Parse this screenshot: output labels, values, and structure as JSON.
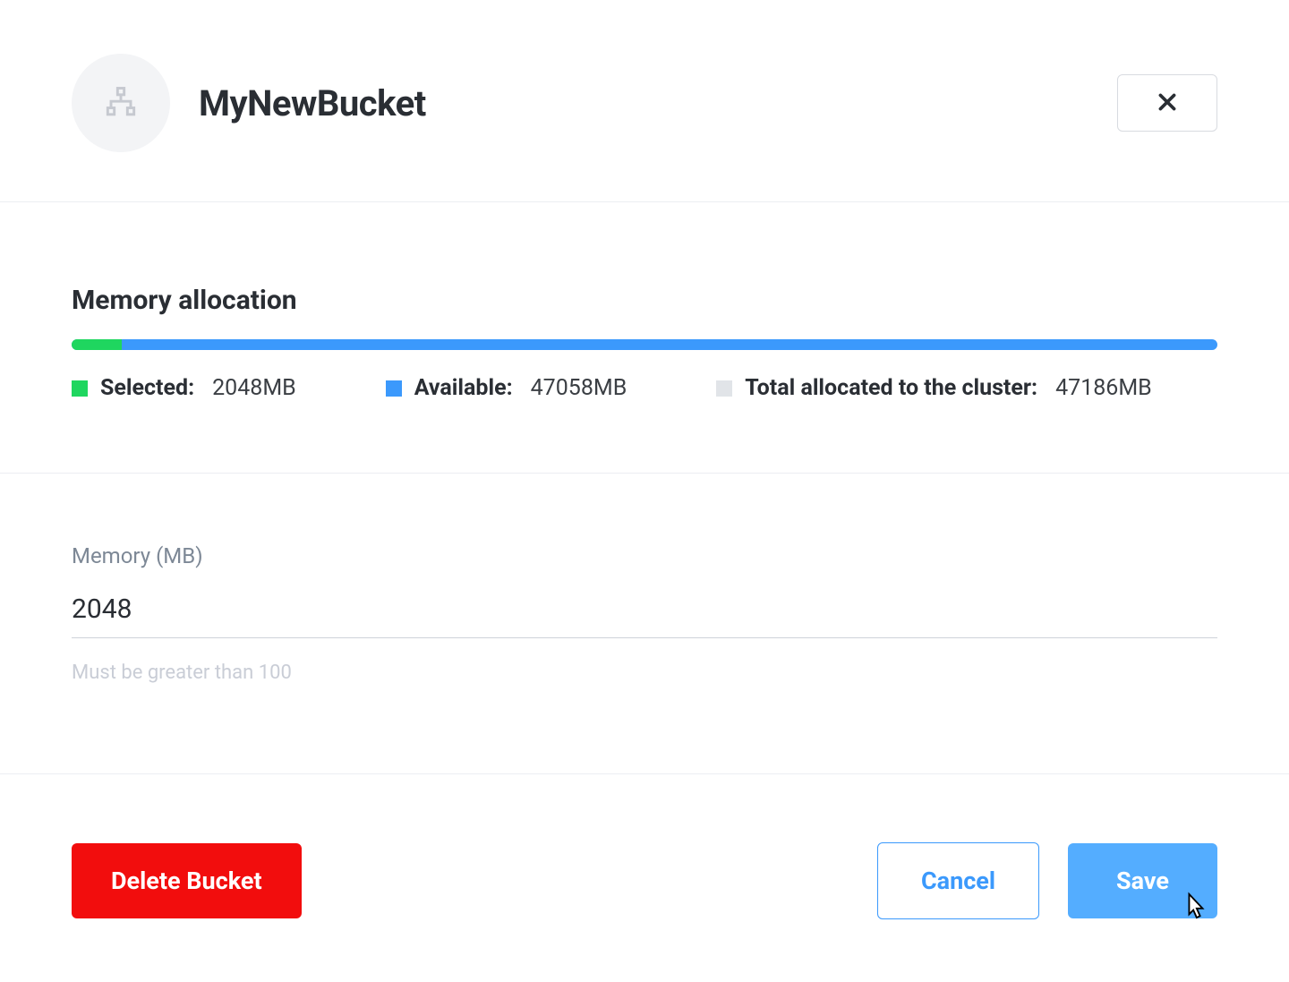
{
  "header": {
    "title": "MyNewBucket"
  },
  "memory": {
    "section_title": "Memory allocation",
    "selected_label": "Selected:",
    "selected_value": "2048MB",
    "available_label": "Available:",
    "available_value": "47058MB",
    "total_label": "Total allocated to the cluster:",
    "total_value": "47186MB",
    "selected_mb": 2048,
    "available_mb": 47058,
    "total_mb": 47186
  },
  "input": {
    "label": "Memory (MB)",
    "value": "2048",
    "hint": "Must be greater than 100"
  },
  "footer": {
    "delete_label": "Delete Bucket",
    "cancel_label": "Cancel",
    "save_label": "Save"
  },
  "chart_data": {
    "type": "bar",
    "title": "Memory allocation",
    "series": [
      {
        "name": "Selected",
        "values": [
          2048
        ],
        "color": "#1fd65f"
      },
      {
        "name": "Available",
        "values": [
          47058
        ],
        "color": "#3b99fc"
      },
      {
        "name": "Total allocated to the cluster",
        "values": [
          47186
        ],
        "color": "#e1e4e8"
      }
    ],
    "xlabel": "",
    "ylabel": "MB",
    "ylim": [
      0,
      47186
    ]
  }
}
